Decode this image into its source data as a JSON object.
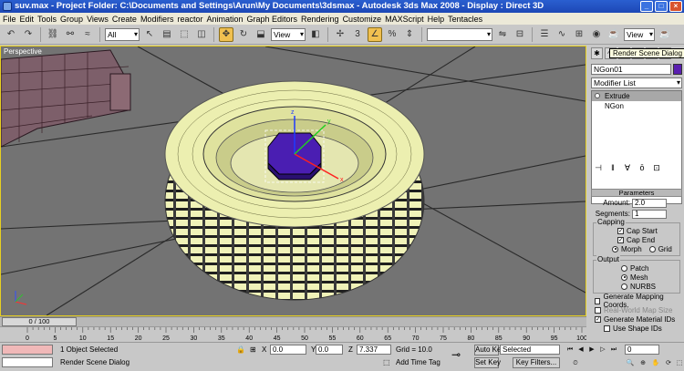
{
  "window": {
    "title": "suv.max     - Project Folder: C:\\Documents and Settings\\Arun\\My Documents\\3dsmax     - Autodesk 3ds Max 2008     - Display : Direct 3D"
  },
  "menu": [
    "File",
    "Edit",
    "Tools",
    "Group",
    "Views",
    "Create",
    "Modifiers",
    "reactor",
    "Animation",
    "Graph Editors",
    "Rendering",
    "Customize",
    "MAXScript",
    "Help",
    "Tentacles"
  ],
  "toolbar": {
    "selection_filter": "All",
    "reference_coord": "View",
    "render_type": "View"
  },
  "tooltip": "Render Scene Dialog",
  "viewport": {
    "label": "Perspective"
  },
  "command_panel": {
    "object_name": "NGon01",
    "object_color": "#5a1fb0",
    "modifier_list": "Modifier List",
    "stack": [
      {
        "label": "Extrude",
        "selected": true
      },
      {
        "label": "NGon",
        "selected": false
      }
    ],
    "parameters": {
      "title": "Parameters",
      "amount_label": "Amount:",
      "amount_value": "2.0",
      "segments_label": "Segments:",
      "segments_value": "1",
      "capping_title": "Capping",
      "cap_start": "Cap Start",
      "cap_end": "Cap End",
      "morph": "Morph",
      "grid": "Grid",
      "output_title": "Output",
      "patch": "Patch",
      "mesh": "Mesh",
      "nurbs": "NURBS",
      "gen_mapping": "Generate Mapping Coords.",
      "real_world": "Real-World Map Size",
      "gen_material": "Generate Material IDs",
      "use_shape": "Use Shape IDs"
    }
  },
  "timeline": {
    "frame": "0 / 100",
    "ticks": [
      "0",
      "5",
      "10",
      "15",
      "20",
      "25",
      "30",
      "35",
      "40",
      "45",
      "50",
      "55",
      "60",
      "65",
      "70",
      "75",
      "80",
      "85",
      "90",
      "95",
      "100"
    ]
  },
  "status": {
    "selection": "1 Object Selected",
    "prompt": "Render Scene Dialog",
    "x_label": "X",
    "x_value": "0.0",
    "y_label": "Y",
    "y_value": "0.0",
    "z_label": "Z",
    "z_value": "7.337",
    "grid": "Grid = 10.0",
    "add_time_tag": "Add Time Tag",
    "auto_key": "Auto Key",
    "selected": "Selected",
    "set_key": "Set Key",
    "key_filters": "Key Filters...",
    "frame_value": "0"
  }
}
